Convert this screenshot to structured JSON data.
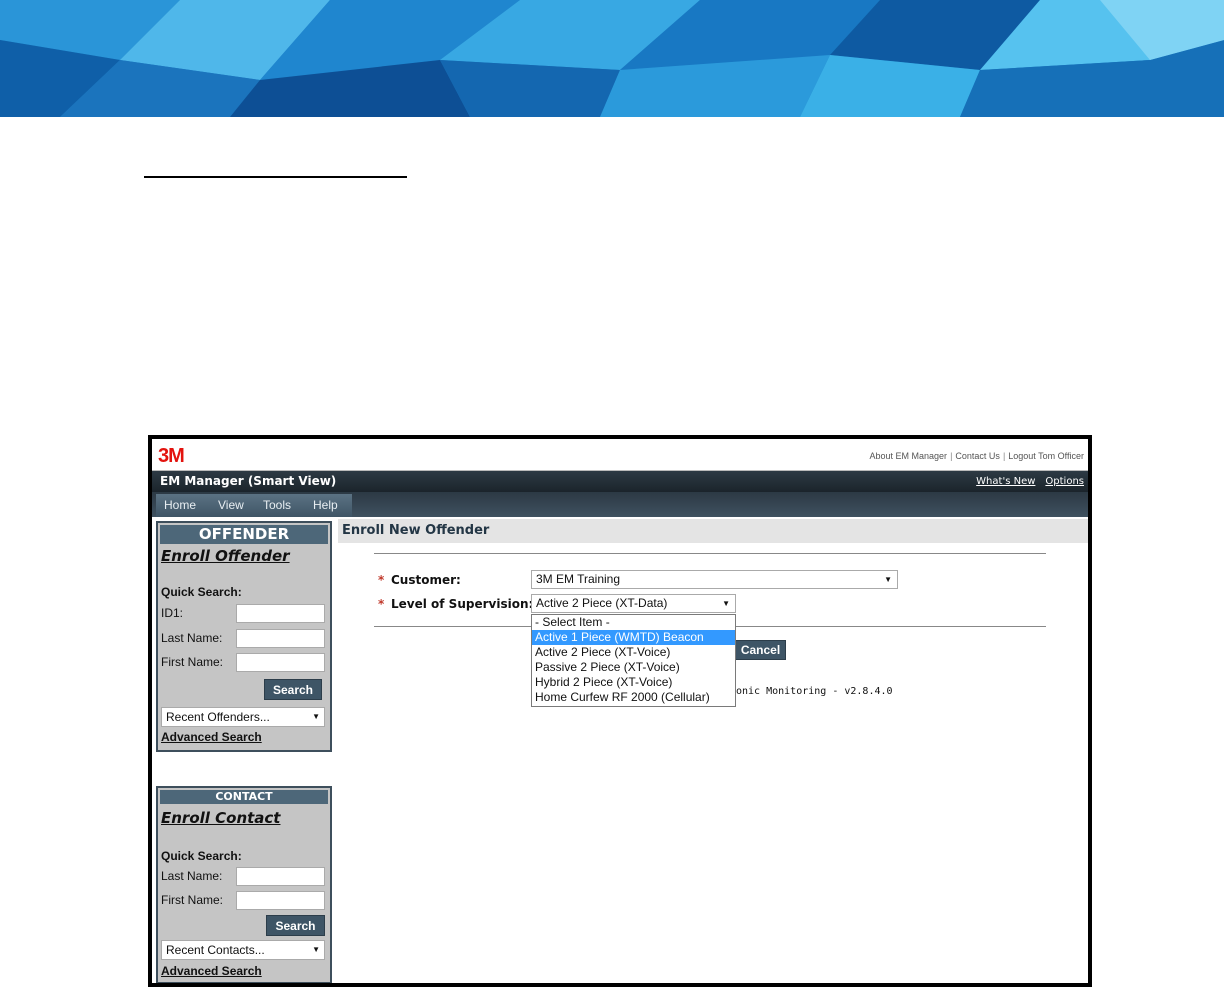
{
  "colors": {
    "accent": "#4d6779",
    "titlebar": "#1b242b",
    "brand_red": "#e3130e",
    "highlight": "#3399ff",
    "banner_blue": "#0a86c9"
  },
  "header": {
    "logo": "3M",
    "top_links": [
      "About EM Manager",
      "Contact Us",
      "Logout Tom Officer"
    ],
    "app_title": "EM Manager (Smart View)",
    "right_links": [
      "What's New",
      "Options"
    ]
  },
  "menu": [
    "Home",
    "View",
    "Tools",
    "Help"
  ],
  "offender_panel": {
    "title": "OFFENDER",
    "enroll_link": "Enroll Offender",
    "quick_search": "Quick Search:",
    "fields": [
      "ID1:",
      "Last Name:",
      "First Name:"
    ],
    "search_button": "Search",
    "recent_select": "Recent Offenders...",
    "advanced_search": "Advanced Search"
  },
  "contact_panel": {
    "title": "CONTACT",
    "enroll_link": "Enroll Contact",
    "quick_search": "Quick Search:",
    "fields": [
      "Last Name:",
      "First Name:"
    ],
    "search_button": "Search",
    "recent_select": "Recent Contacts...",
    "advanced_search": "Advanced Search"
  },
  "main": {
    "heading": "Enroll New Offender",
    "required_marker": "*",
    "customer_label": "Customer:",
    "customer_value": "3M EM Training",
    "supervision_label": "Level of Supervision:",
    "supervision_value": "Active 2 Piece (XT-Data)",
    "supervision_options": [
      "- Select Item -",
      "Active 1 Piece (WMTD) Beacon",
      "Active 2 Piece (XT-Voice)",
      "Passive 2 Piece (XT-Voice)",
      "Hybrid 2 Piece (XT-Voice)",
      "Home Curfew RF 2000 (Cellular)"
    ],
    "highlighted_option": "Active 1 Piece (WMTD) Beacon",
    "cancel_button": "Cancel",
    "version_text": "onic Monitoring - v2.8.4.0"
  }
}
